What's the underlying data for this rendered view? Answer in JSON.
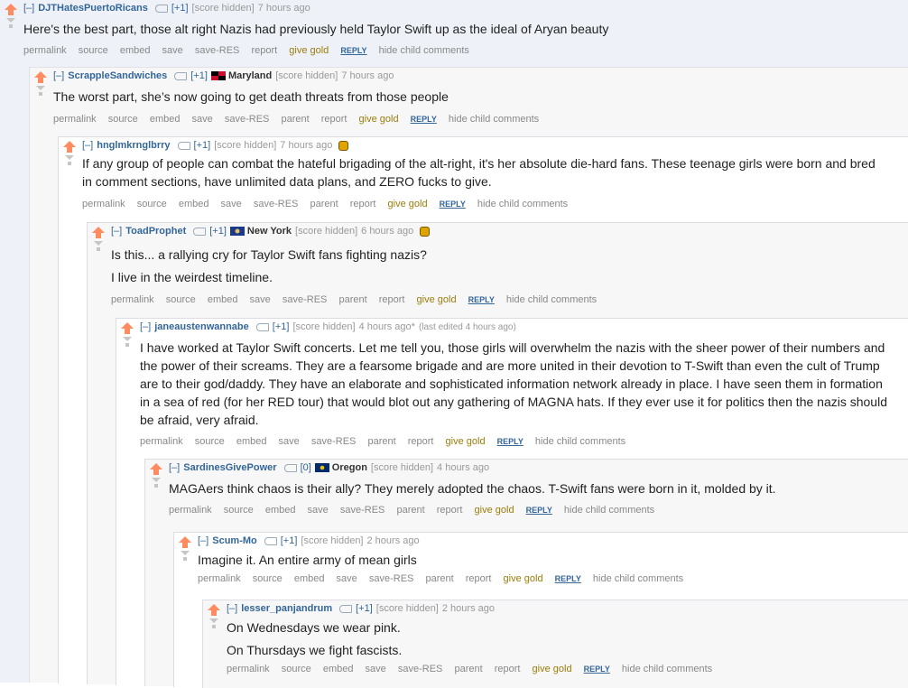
{
  "labels": {
    "expand": "[–]",
    "score_hidden": "[score hidden]",
    "permalink": "permalink",
    "source": "source",
    "embed": "embed",
    "save": "save",
    "save_res": "save-RES",
    "parent": "parent",
    "report": "report",
    "give_gold": "give gold",
    "reply": "REPLY",
    "hide_child": "hide child comments"
  },
  "colors": {
    "upvote": "#ff8b60",
    "link": "#336699",
    "gold": "#9a7d0a"
  },
  "comments": [
    {
      "author": "DJTHatesPuertoRicans",
      "points": "[+1]",
      "time": "7 hours ago",
      "body": [
        "Here's the best part, those alt right Nazis had previously held Taylor Swift up as the ideal of Aryan beauty"
      ]
    },
    {
      "author": "ScrappleSandwiches",
      "points": "[+1]",
      "flair": "Maryland",
      "time": "7 hours ago",
      "body": [
        "The worst part, she’s now going to get death threats from those people"
      ]
    },
    {
      "author": "hnglmkrnglbrry",
      "points": "[+1]",
      "time": "7 hours ago",
      "body": [
        "If any group of people can combat the hateful brigading of the alt-right, it's her absolute die-hard fans. These teenage girls were born and bred in comment sections, have unlimited data plans, and ZERO fucks to give."
      ]
    },
    {
      "author": "ToadProphet",
      "points": "[+1]",
      "flair": "New York",
      "time": "6 hours ago",
      "body": [
        "Is this... a rallying cry for Taylor Swift fans fighting nazis?",
        "I live in the weirdest timeline."
      ]
    },
    {
      "author": "janeaustenwannabe",
      "points": "[+1]",
      "time": "4 hours ago*",
      "edited": "(last edited 4 hours ago)",
      "body": [
        "I have worked at Taylor Swift concerts. Let me tell you, those girls will overwhelm the nazis with the sheer power of their numbers and the power of their screams. They are a fearsome brigade and are more united in their devotion to T-Swift than even the cult of Trump are to their god/daddy. They have an elaborate and sophisticated information network already in place. I have seen them in formation in a sea of red (for her RED tour) that would blot out any gathering of MAGNA hats. If they ever use it for politics then the nazis should be afraid, very afraid."
      ]
    },
    {
      "author": "SardinesGivePower",
      "points": "[0]",
      "flair": "Oregon",
      "time": "4 hours ago",
      "body": [
        "MAGAers think chaos is their ally? They merely adopted the chaos. T-Swift fans were born in it, molded by it."
      ]
    },
    {
      "author": "Scum-Mo",
      "points": "[+1]",
      "time": "2 hours ago",
      "body": [
        "Imagine it. An entire army of mean girls"
      ]
    },
    {
      "author": "lesser_panjandrum",
      "points": "[+1]",
      "time": "2 hours ago",
      "body": [
        "On Wednesdays we wear pink.",
        "On Thursdays we fight fascists."
      ]
    }
  ]
}
